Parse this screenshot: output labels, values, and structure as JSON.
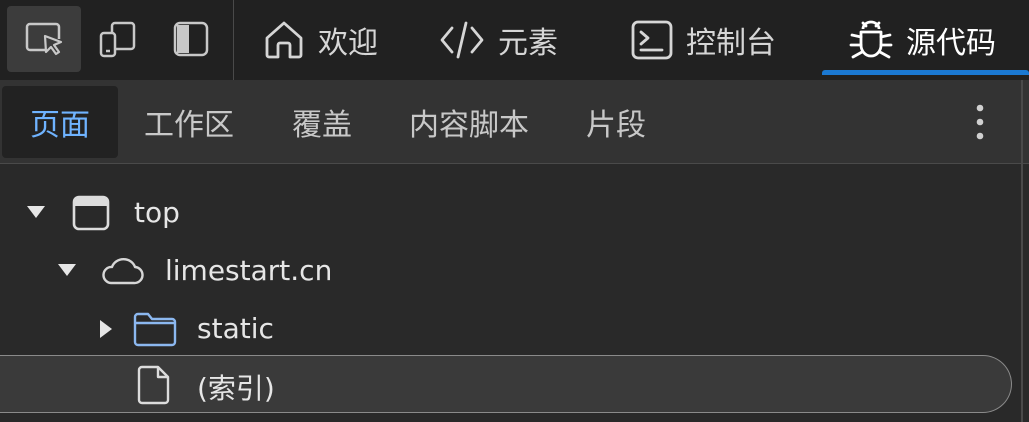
{
  "toolbar": {
    "tools": [
      {
        "name": "inspect-element-button",
        "icon": "inspect-icon",
        "active": true
      },
      {
        "name": "device-emulation-button",
        "icon": "device-icon",
        "active": false
      },
      {
        "name": "toggle-sidebar-button",
        "icon": "sidebar-icon",
        "active": false
      }
    ],
    "tabs": [
      {
        "label": "欢迎",
        "icon": "home-icon",
        "selected": false
      },
      {
        "label": "元素",
        "icon": "code-icon",
        "selected": false
      },
      {
        "label": "控制台",
        "icon": "console-icon",
        "selected": false
      },
      {
        "label": "源代码",
        "icon": "bug-icon",
        "selected": true
      }
    ]
  },
  "subtabs": [
    {
      "label": "页面",
      "selected": true
    },
    {
      "label": "工作区",
      "selected": false
    },
    {
      "label": "覆盖",
      "selected": false
    },
    {
      "label": "内容脚本",
      "selected": false
    },
    {
      "label": "片段",
      "selected": false
    }
  ],
  "tree": [
    {
      "label": "top",
      "icon": "frame-icon",
      "expanded": true,
      "level": 0
    },
    {
      "label": "limestart.cn",
      "icon": "cloud-icon",
      "expanded": true,
      "level": 1
    },
    {
      "label": "static",
      "icon": "folder-icon",
      "expanded": false,
      "level": 2
    },
    {
      "label": "(索引)",
      "icon": "file-icon",
      "expanded": null,
      "level": 2,
      "selected": true
    }
  ],
  "colors": {
    "accent": "#1b79d2",
    "selected_subtab_text": "#6fb3ff",
    "folder": "#8cb8f0"
  }
}
